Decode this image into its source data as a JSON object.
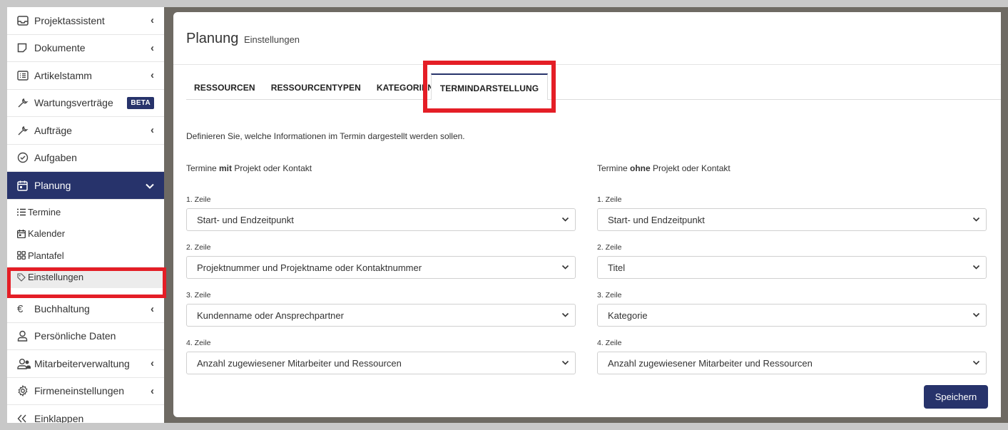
{
  "sidebar": {
    "items": [
      {
        "label": "Projektassistent",
        "icon": "inbox-icon",
        "chevron": "‹"
      },
      {
        "label": "Dokumente",
        "icon": "document-icon",
        "chevron": "‹"
      },
      {
        "label": "Artikelstamm",
        "icon": "list-icon",
        "chevron": "‹"
      },
      {
        "label": "Wartungsverträge",
        "icon": "wrench-icon",
        "badge": "BETA"
      },
      {
        "label": "Aufträge",
        "icon": "wrench-icon",
        "chevron": "‹"
      },
      {
        "label": "Aufgaben",
        "icon": "check-circle-icon"
      },
      {
        "label": "Planung",
        "icon": "calendar-icon",
        "chevron": "⌄"
      }
    ],
    "subitems": [
      {
        "label": "Termine",
        "icon": "list-icon"
      },
      {
        "label": "Kalender",
        "icon": "calendar-icon"
      },
      {
        "label": "Plantafel",
        "icon": "grid-icon"
      },
      {
        "label": "Einstellungen",
        "icon": "tag-icon"
      }
    ],
    "bottom_items": [
      {
        "label": "Buchhaltung",
        "icon": "euro-icon",
        "chevron": "‹"
      },
      {
        "label": "Persönliche Daten",
        "icon": "user-icon"
      },
      {
        "label": "Mitarbeiterverwaltung",
        "icon": "users-icon",
        "chevron": "‹"
      },
      {
        "label": "Firmeneinstellungen",
        "icon": "gear-icon",
        "chevron": "‹"
      },
      {
        "label": "Einklappen",
        "icon": "double-chevron-left-icon"
      }
    ]
  },
  "header": {
    "title": "Planung",
    "subtitle": "Einstellungen"
  },
  "tabs": [
    "RESSOURCEN",
    "RESSOURCENTYPEN",
    "KATEGORIEN",
    "TERMINDARSTELLUNG"
  ],
  "active_tab": "TERMINDARSTELLUNG",
  "description": "Definieren Sie, welche Informationen im Termin dargestellt werden sollen.",
  "left": {
    "heading_pre": "Termine ",
    "heading_bold": "mit",
    "heading_post": " Projekt oder Kontakt",
    "fields": [
      {
        "label": "1. Zeile",
        "value": "Start- und Endzeitpunkt"
      },
      {
        "label": "2. Zeile",
        "value": "Projektnummer und Projektname oder Kontaktnummer"
      },
      {
        "label": "3. Zeile",
        "value": "Kundenname oder Ansprechpartner"
      },
      {
        "label": "4. Zeile",
        "value": "Anzahl zugewiesener Mitarbeiter und Ressourcen"
      }
    ]
  },
  "right": {
    "heading_pre": "Termine ",
    "heading_bold": "ohne",
    "heading_post": " Projekt oder Kontakt",
    "fields": [
      {
        "label": "1. Zeile",
        "value": "Start- und Endzeitpunkt"
      },
      {
        "label": "2. Zeile",
        "value": "Titel"
      },
      {
        "label": "3. Zeile",
        "value": "Kategorie"
      },
      {
        "label": "4. Zeile",
        "value": "Anzahl zugewiesener Mitarbeiter und Ressourcen"
      }
    ]
  },
  "save_label": "Speichern",
  "colors": {
    "accent": "#27336b",
    "highlight": "#e41e26"
  }
}
